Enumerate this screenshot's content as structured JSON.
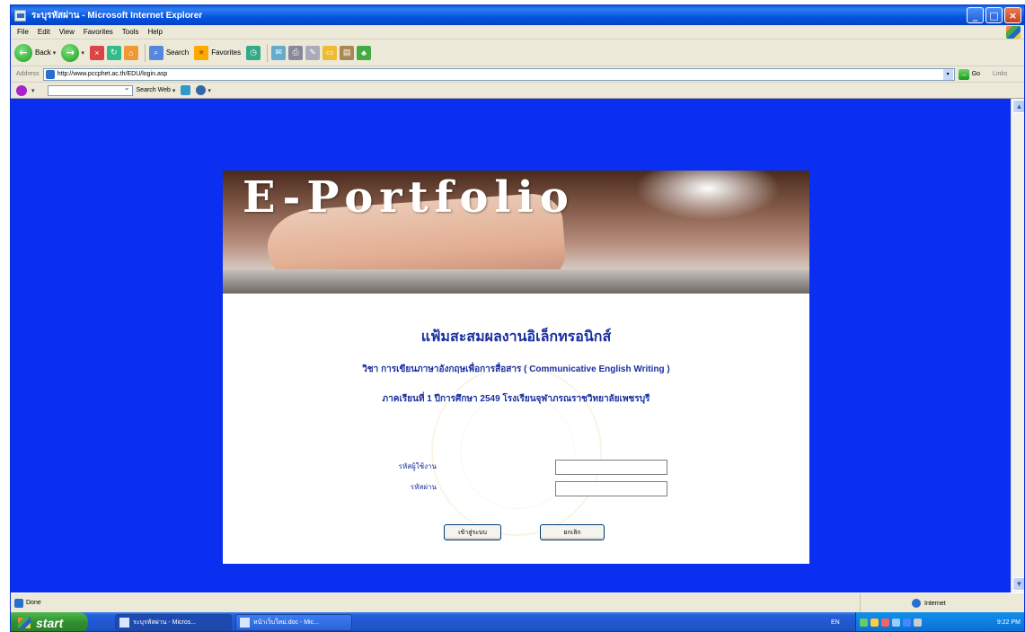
{
  "window": {
    "title": "ระบุรหัสผ่าน - Microsoft Internet Explorer",
    "minimize": "_",
    "maximize": "□",
    "close": "×"
  },
  "menu": [
    "File",
    "Edit",
    "View",
    "Favorites",
    "Tools",
    "Help"
  ],
  "toolbar": {
    "back": "Back",
    "search": "Search",
    "favorites": "Favorites"
  },
  "address": {
    "label": "Address",
    "url": "http://www.pccphet.ac.th/EDU/login.asp",
    "go": "Go",
    "links": "Links"
  },
  "searchbar": {
    "search_label": "Search Web"
  },
  "page": {
    "logo": "E-Portfolio",
    "heading": "แฟ้มสะสมผลงานอิเล็กทรอนิกส์",
    "subject": "วิชา การเขียนภาษาอังกฤษเพื่อการสื่อสาร ( Communicative English Writing )",
    "term": "ภาคเรียนที่ 1  ปีการศึกษา 2549  โรงเรียนจุฬาภรณราชวิทยาลัยเพชรบุรี",
    "username_label": "รหัสผู้ใช้งาน",
    "username_value": "",
    "password_label": "รหัสผ่าน",
    "password_value": "",
    "login_button": "เข้าสู่ระบบ",
    "cancel_button": "ยกเลิก"
  },
  "status": {
    "text": "Done",
    "zone": "Internet"
  },
  "taskbar": {
    "start": "start",
    "tasks": [
      "ระบุรหัสผ่าน - Micros...",
      "หน้าเว็บใหม่.doc - Mic..."
    ],
    "lang": "EN",
    "clock": "9:22 PM"
  }
}
